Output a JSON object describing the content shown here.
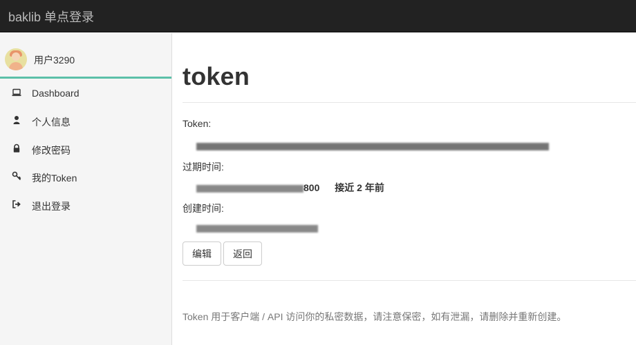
{
  "navbar": {
    "brand": "baklib 单点登录"
  },
  "sidebar": {
    "user": {
      "name": "用户3290"
    },
    "items": [
      {
        "label": "Dashboard",
        "icon": "laptop-icon"
      },
      {
        "label": "个人信息",
        "icon": "user-icon"
      },
      {
        "label": "修改密码",
        "icon": "lock-icon"
      },
      {
        "label": "我的Token",
        "icon": "key-icon"
      },
      {
        "label": "退出登录",
        "icon": "sign-out-icon"
      }
    ],
    "accent_color": "#5bc0a8"
  },
  "main": {
    "title": "token",
    "fields": {
      "token_label": "Token:",
      "expire_label": "过期时间:",
      "expire_value_suffix": "800",
      "expire_relative": "接近 2 年前",
      "created_label": "创建时间:"
    },
    "buttons": {
      "edit": "编辑",
      "back": "返回"
    },
    "help_text": "Token 用于客户端 / API 访问你的私密数据，请注意保密，如有泄漏，请删除并重新创建。"
  }
}
